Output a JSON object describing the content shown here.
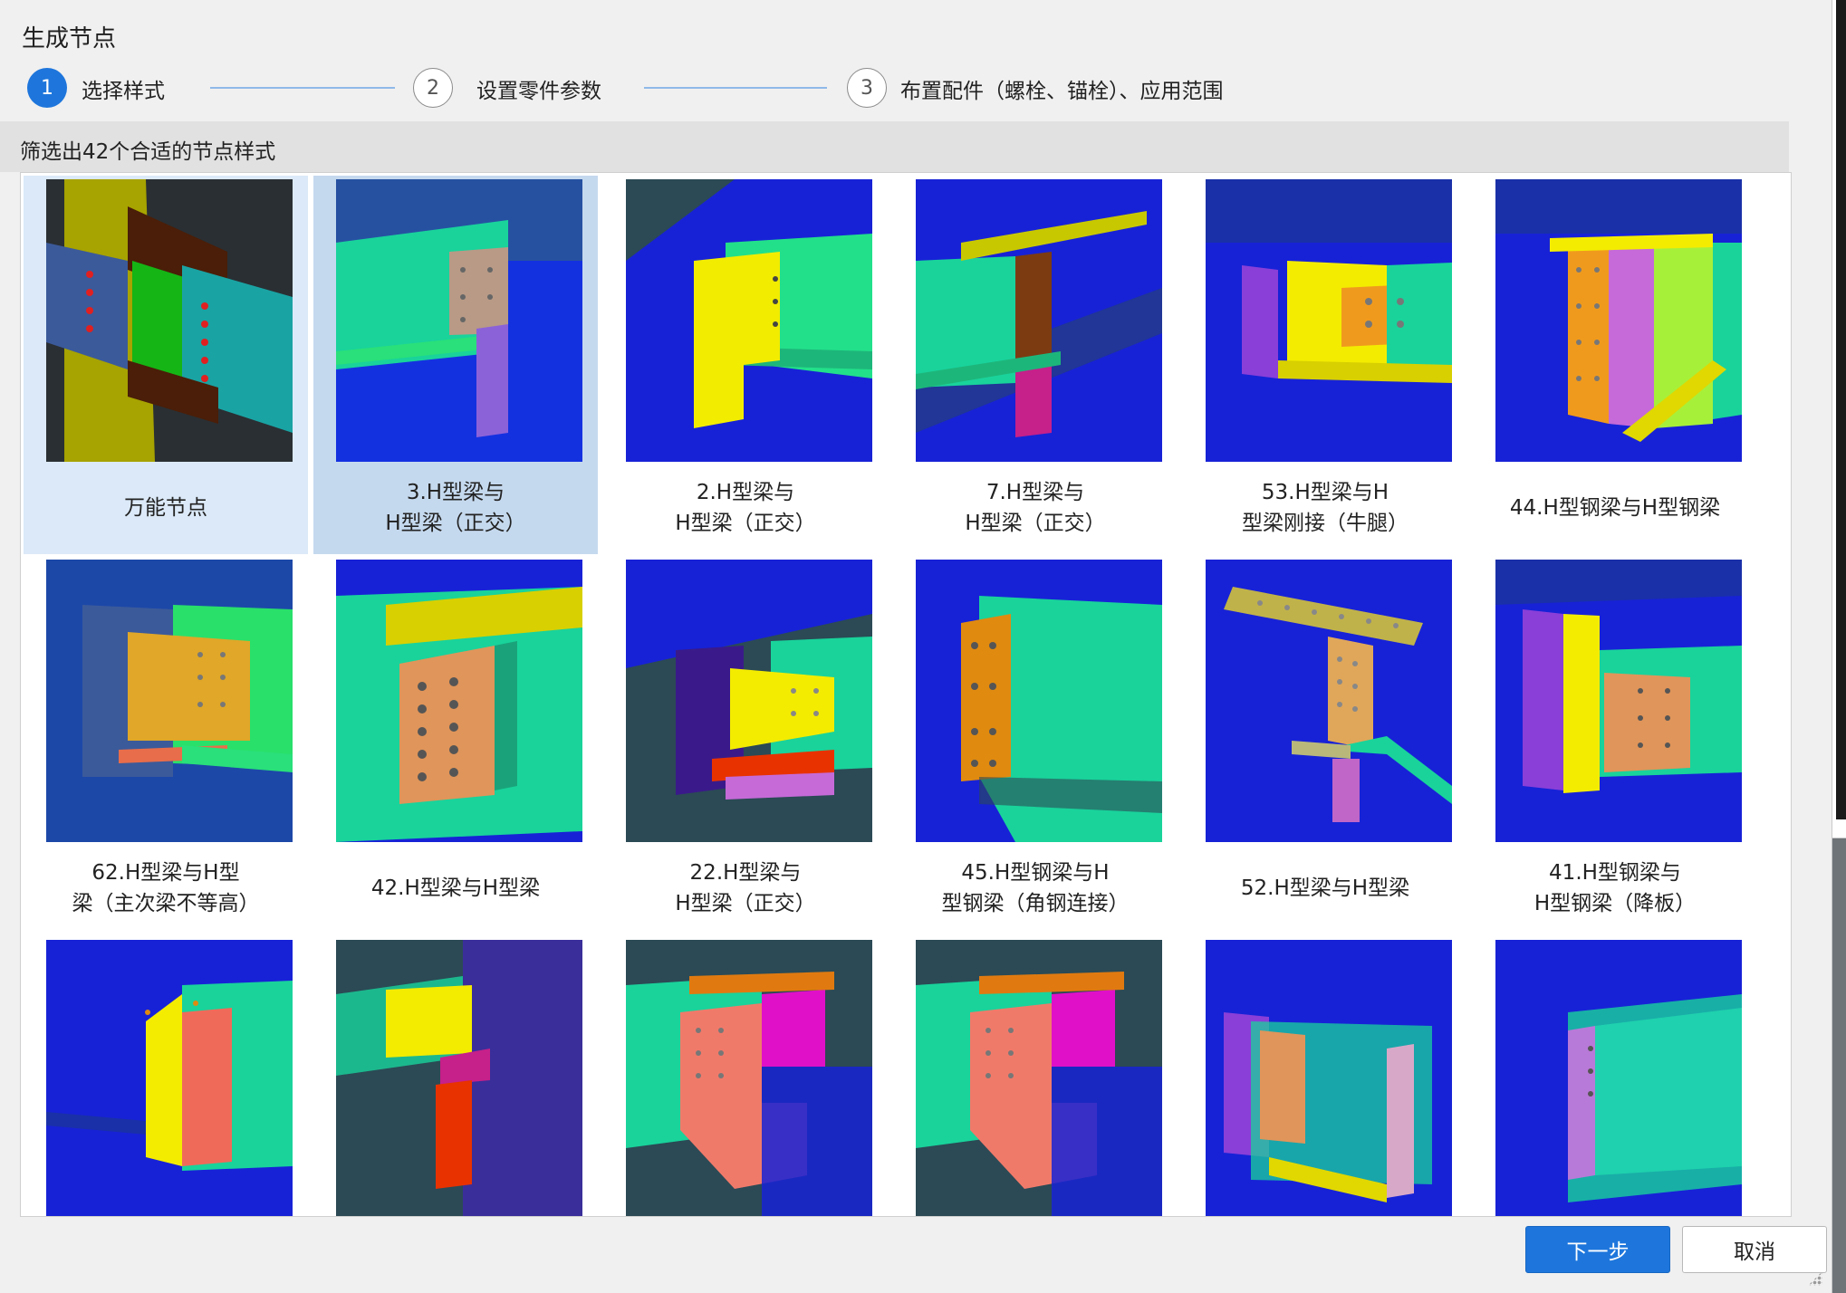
{
  "dialog": {
    "title": "生成节点",
    "steps": [
      {
        "number": "1",
        "label": "选择样式",
        "state": "active"
      },
      {
        "number": "2",
        "label": "设置零件参数",
        "state": "idle"
      },
      {
        "number": "3",
        "label": "布置配件（螺栓、锚栓）、应用范围",
        "state": "idle"
      }
    ],
    "filter_text": "筛选出42个合适的节点样式",
    "tiles": [
      {
        "caption": "万能节点",
        "state": "hover"
      },
      {
        "caption": "3.H型梁与\nH型梁（正交）",
        "state": "selected"
      },
      {
        "caption": "2.H型梁与\nH型梁（正交）",
        "state": "normal"
      },
      {
        "caption": "7.H型梁与\nH型梁（正交）",
        "state": "normal"
      },
      {
        "caption": "53.H型梁与H\n型梁刚接（牛腿）",
        "state": "normal"
      },
      {
        "caption": "44.H型钢梁与H型钢梁",
        "state": "normal"
      },
      {
        "caption": "62.H型梁与H型\n梁（主次梁不等高）",
        "state": "normal"
      },
      {
        "caption": "42.H型梁与H型梁",
        "state": "normal"
      },
      {
        "caption": "22.H型梁与\nH型梁（正交）",
        "state": "normal"
      },
      {
        "caption": "45.H型钢梁与H\n型钢梁（角钢连接）",
        "state": "normal"
      },
      {
        "caption": "52.H型梁与H型梁",
        "state": "normal"
      },
      {
        "caption": "41.H型钢梁与\nH型钢梁（降板）",
        "state": "normal"
      },
      {
        "caption": "",
        "state": "normal"
      },
      {
        "caption": "",
        "state": "normal"
      },
      {
        "caption": "",
        "state": "normal"
      },
      {
        "caption": "",
        "state": "normal"
      },
      {
        "caption": "",
        "state": "normal"
      },
      {
        "caption": "",
        "state": "normal"
      }
    ],
    "buttons": {
      "next": "下一步",
      "cancel": "取消"
    }
  },
  "colors": {
    "accent": "#1e76dc",
    "step_line": "#8fb9e8",
    "selected_tile": "#c5d9ee",
    "hover_tile": "#dbe9f8"
  },
  "icons": [
    "steel-joint-thumbnail-icon",
    "resize-grip-icon"
  ]
}
